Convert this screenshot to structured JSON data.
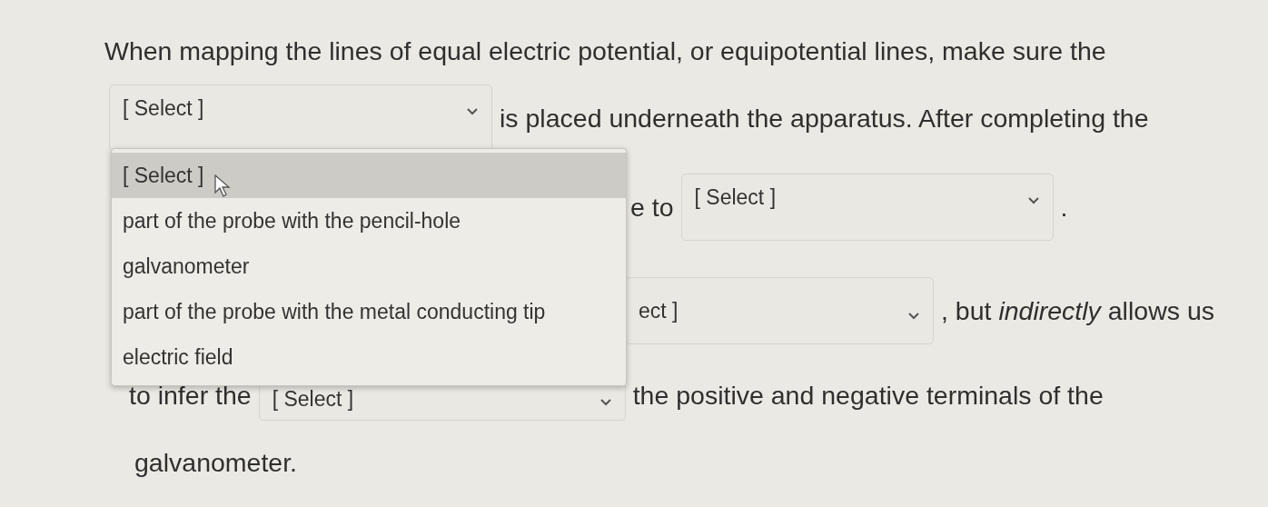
{
  "lines": [
    {
      "segments": [
        {
          "kind": "text",
          "text": "When mapping the lines of equal electric potential, or equipotential lines, make sure the"
        }
      ]
    },
    {
      "segments": [
        {
          "kind": "select",
          "value": "[ Select ]"
        },
        {
          "kind": "text",
          "text": "is placed underneath the apparatus. After completing the"
        }
      ]
    },
    {
      "segments": [
        {
          "kind": "text",
          "text": "e to"
        },
        {
          "kind": "select",
          "value": "[ Select ]"
        },
        {
          "kind": "text",
          "text": "."
        }
      ]
    },
    {
      "segments": [
        {
          "kind": "select",
          "value": "ect ]"
        },
        {
          "kind": "text",
          "text": ", but *indirectly* allows us"
        }
      ]
    },
    {
      "segments": [
        {
          "kind": "text",
          "text": "to infer the"
        },
        {
          "kind": "select",
          "value": "[ Select ]"
        },
        {
          "kind": "text",
          "text": "the positive and negative terminals of the"
        }
      ]
    },
    {
      "segments": [
        {
          "kind": "text",
          "text": "galvanometer."
        }
      ]
    }
  ],
  "dropdown_menu": {
    "options": [
      {
        "label": "[ Select ]",
        "selected": true
      },
      {
        "label": "part of the probe with the pencil-hole",
        "selected": false
      },
      {
        "label": "galvanometer",
        "selected": false
      },
      {
        "label": "part of the probe with the metal conducting tip",
        "selected": false
      },
      {
        "label": "electric field",
        "selected": false
      }
    ]
  }
}
